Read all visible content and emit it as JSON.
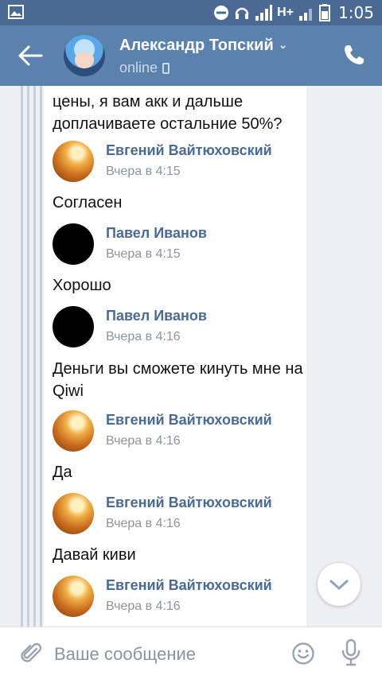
{
  "status_bar": {
    "network": "H+",
    "time": "1:05"
  },
  "header": {
    "contact_name": "Александр Топский",
    "status": "online"
  },
  "messages": [
    {
      "type": "text",
      "text": "цены,  я вам акк и дальше доплачиваете остальние  50%?"
    },
    {
      "type": "author",
      "name": "Евгений Вайтюховский",
      "time": "Вчера в 4:15"
    },
    {
      "type": "text",
      "text": "Согласен"
    },
    {
      "type": "author",
      "name": "Павел Иванов",
      "time": "Вчера в 4:15"
    },
    {
      "type": "text",
      "text": "Хорошо"
    },
    {
      "type": "author",
      "name": "Павел Иванов",
      "time": "Вчера в 4:16"
    },
    {
      "type": "text",
      "text": "Деньги вы сможете кинуть мне на Qiwi"
    },
    {
      "type": "author",
      "name": "Евгений Вайтюховский",
      "time": "Вчера в 4:16"
    },
    {
      "type": "text",
      "text": "Да"
    },
    {
      "type": "author",
      "name": "Евгений Вайтюховский",
      "time": "Вчера в 4:16"
    },
    {
      "type": "text",
      "text": "Давай киви"
    },
    {
      "type": "author",
      "name": "Евгений Вайтюховский",
      "time": "Вчера в 4:16"
    }
  ],
  "composer": {
    "placeholder": "Ваше сообщение"
  },
  "colors": {
    "status_bar": "#4a6a93",
    "app_bar": "#5b81ad",
    "author_name": "#4a6a93"
  }
}
